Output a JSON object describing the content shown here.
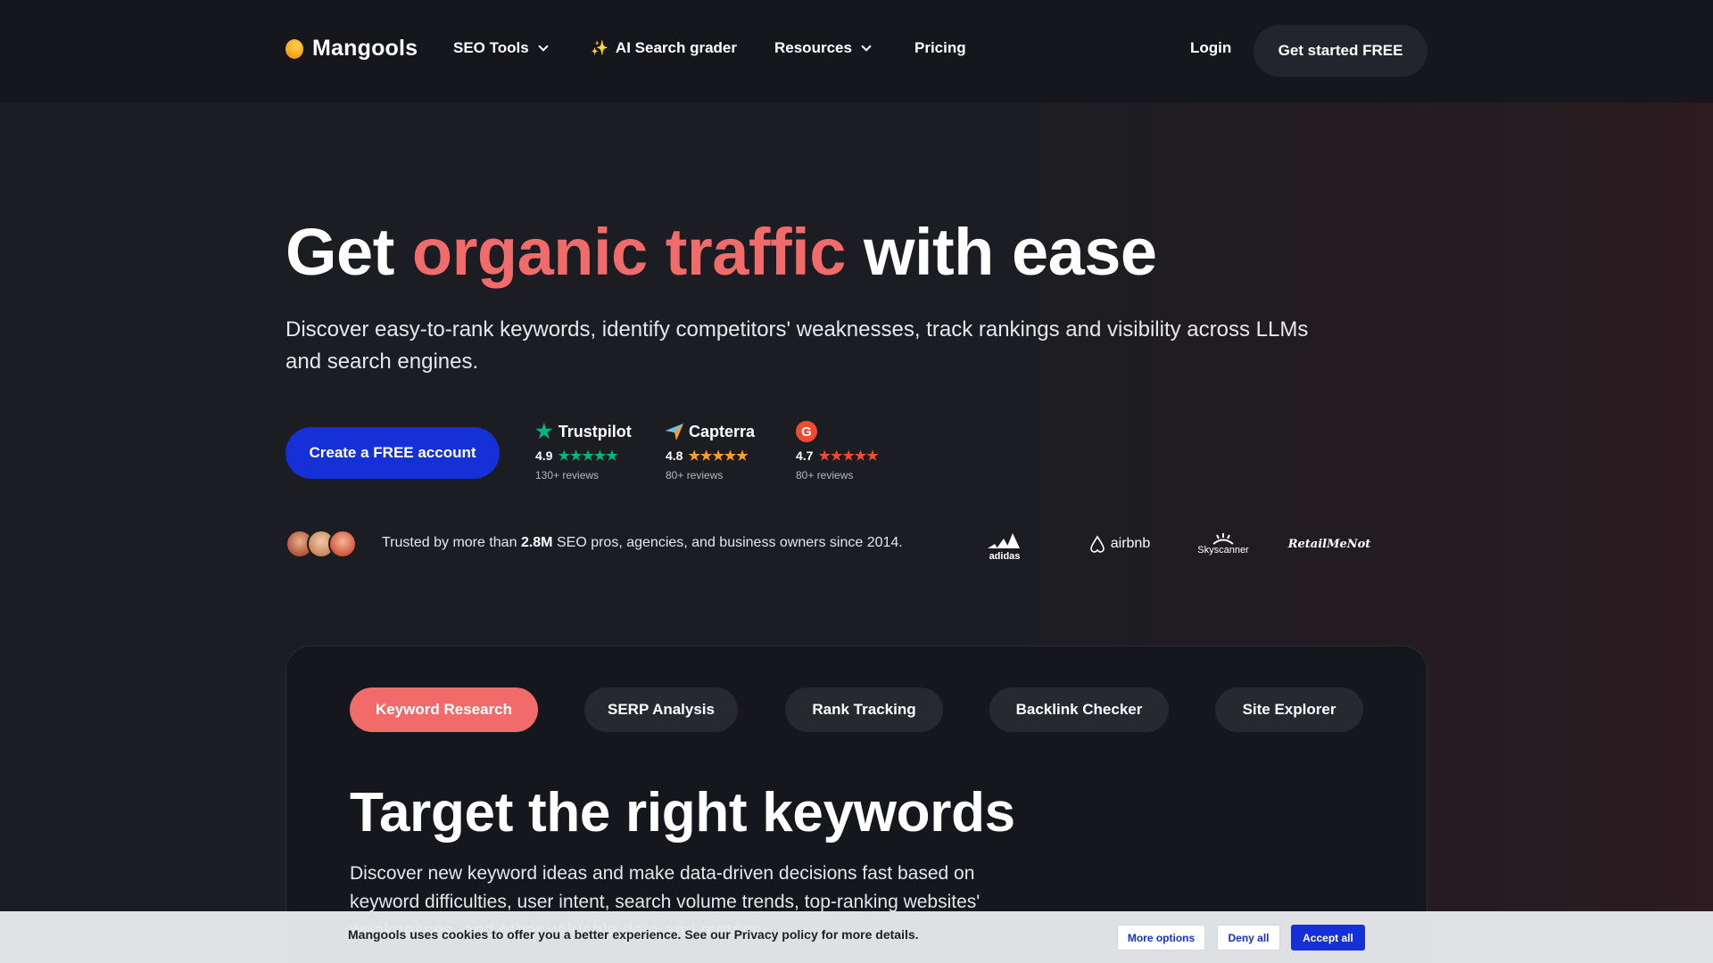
{
  "nav": {
    "logo": "Mangools",
    "items": [
      {
        "label": "SEO Tools"
      },
      {
        "label": "AI Search grader",
        "sparkle": "✨"
      },
      {
        "label": "Resources"
      },
      {
        "label": "Pricing"
      }
    ],
    "login": "Login",
    "cta": "Get started FREE"
  },
  "hero": {
    "title_pre": "Get",
    "title_accent": "organic traffic",
    "title_post": "with ease",
    "subtitle": "Discover easy-to-rank keywords, identify competitors' weaknesses, track rankings and visibility across LLMs and search engines.",
    "cta": "Create a FREE account",
    "accent_color": "#f26b6b"
  },
  "ratings": [
    {
      "brand": "Trustpilot",
      "score": "4.9",
      "reviews": "130+ reviews",
      "stars": 5,
      "star_color": "#00b67a"
    },
    {
      "brand": "Capterra",
      "score": "4.8",
      "reviews": "80+ reviews",
      "stars": 5,
      "star_color": "#ff9d28"
    },
    {
      "brand": "G2",
      "score": "4.7",
      "reviews": "80+ reviews",
      "stars": 5,
      "star_color": "#ef4a35"
    }
  ],
  "trust": {
    "pre": "Trusted by more than",
    "highlight": "2.8M",
    "post": "SEO pros, agencies, and business owners since 2014.",
    "partners": [
      "adidas",
      "airbnb",
      "Skyscanner",
      "RetailMeNot"
    ]
  },
  "tabs": [
    {
      "label": "Keyword Research",
      "active": true
    },
    {
      "label": "SERP Analysis",
      "active": false
    },
    {
      "label": "Rank Tracking",
      "active": false
    },
    {
      "label": "Backlink Checker",
      "active": false
    },
    {
      "label": "Site Explorer",
      "active": false
    }
  ],
  "section": {
    "title": "Target the right keywords",
    "subtitle": "Discover new keyword ideas and make data-driven decisions fast based on keyword difficulties, user intent, search volume trends, top-ranking websites' weaknesses, and other valuable data and metrics."
  },
  "cookie": {
    "text": "Mangools uses cookies to offer you a better experience. See our Privacy policy for more details.",
    "more": "More options",
    "deny": "Deny all",
    "accept": "Accept all"
  }
}
